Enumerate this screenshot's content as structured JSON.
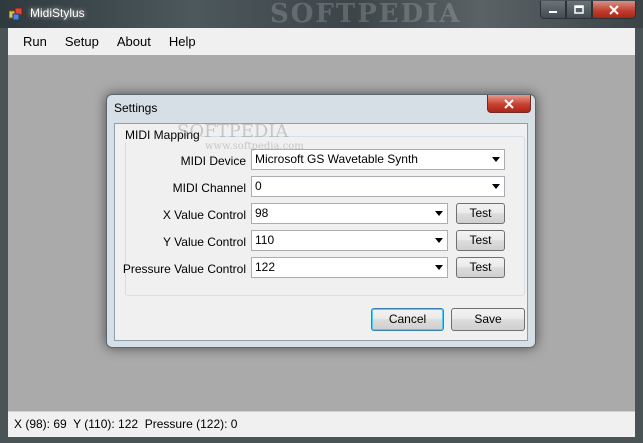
{
  "window": {
    "title": "MidiStylus",
    "watermark": "SOFTPEDIA"
  },
  "menu": [
    "Run",
    "Setup",
    "About",
    "Help"
  ],
  "status": {
    "text": "X (98): 69  Y (110): 122  Pressure (122): 0"
  },
  "dialog": {
    "title": "Settings",
    "watermark": "SOFTPEDIA",
    "watermark_url": "www.softpedia.com",
    "group_label": "MIDI Mapping",
    "rows": [
      {
        "label": "MIDI Device",
        "value": "Microsoft GS Wavetable Synth",
        "test": ""
      },
      {
        "label": "MIDI Channel",
        "value": "0",
        "test": ""
      },
      {
        "label": "X Value Control",
        "value": "98",
        "test": "Test"
      },
      {
        "label": "Y Value Control",
        "value": "110",
        "test": "Test"
      },
      {
        "label": "Pressure Value Control",
        "value": "122",
        "test": "Test"
      }
    ],
    "cancel_label": "Cancel",
    "save_label": "Save"
  },
  "icons": {
    "app": "midistylus-app-icon",
    "minimize": "minimize-icon",
    "maximize": "maximize-icon",
    "close": "close-icon",
    "dropdown": "chevron-down-icon"
  }
}
